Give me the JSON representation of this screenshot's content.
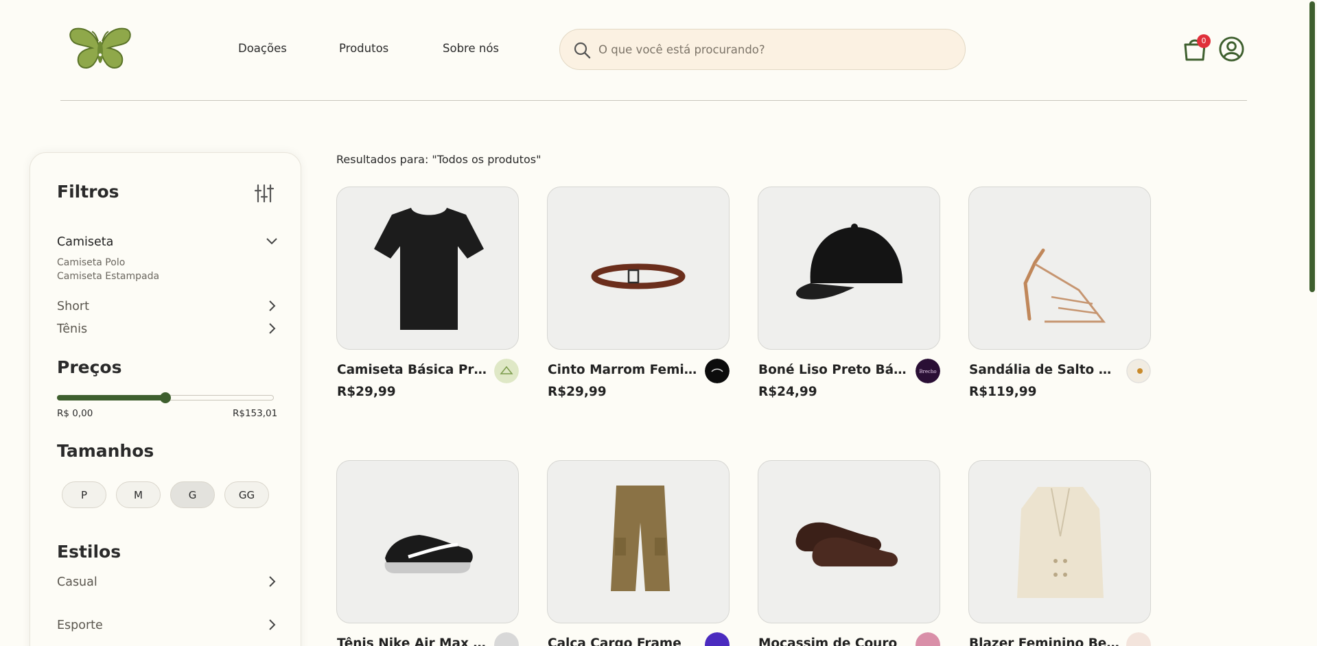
{
  "header": {
    "nav": [
      "Doações",
      "Produtos",
      "Sobre nós"
    ],
    "search_placeholder": "O que você está procurando?",
    "cart_count": "0"
  },
  "sidebar": {
    "filters_title": "Filtros",
    "category_open": "Camiseta",
    "subcategories": [
      "Camiseta Polo",
      "Camiseta Estampada"
    ],
    "categories": [
      "Short",
      "Tênis"
    ],
    "prices_title": "Preços",
    "price_min": "R$ 0,00",
    "price_max": "R$153,01",
    "price_slider_fraction": 0.5,
    "sizes_title": "Tamanhos",
    "sizes": [
      "P",
      "M",
      "G",
      "GG"
    ],
    "size_selected": "G",
    "styles_title": "Estilos",
    "styles": [
      "Casual",
      "Esporte"
    ]
  },
  "main": {
    "results_label": "Resultados para: \"Todos os produtos\"",
    "products": [
      {
        "name": "Camiseta Básica Preta",
        "price": "R$29,99"
      },
      {
        "name": "Cinto Marrom Feminino",
        "price": "R$29,99"
      },
      {
        "name": "Boné Liso Preto Básico",
        "price": "R$24,99"
      },
      {
        "name": "Sandália de Salto Alto",
        "price": "R$119,99"
      },
      {
        "name": "Tênis Nike Air Max Excee",
        "price": ""
      },
      {
        "name": "Calça Cargo Frame",
        "price": ""
      },
      {
        "name": "Mocassim de Couro",
        "price": ""
      },
      {
        "name": "Blazer Feminino Bege",
        "price": ""
      }
    ]
  },
  "colors": {
    "brand_green": "#3e5f2e",
    "background": "#fdfcf6",
    "badge_red": "#e02f3a"
  }
}
